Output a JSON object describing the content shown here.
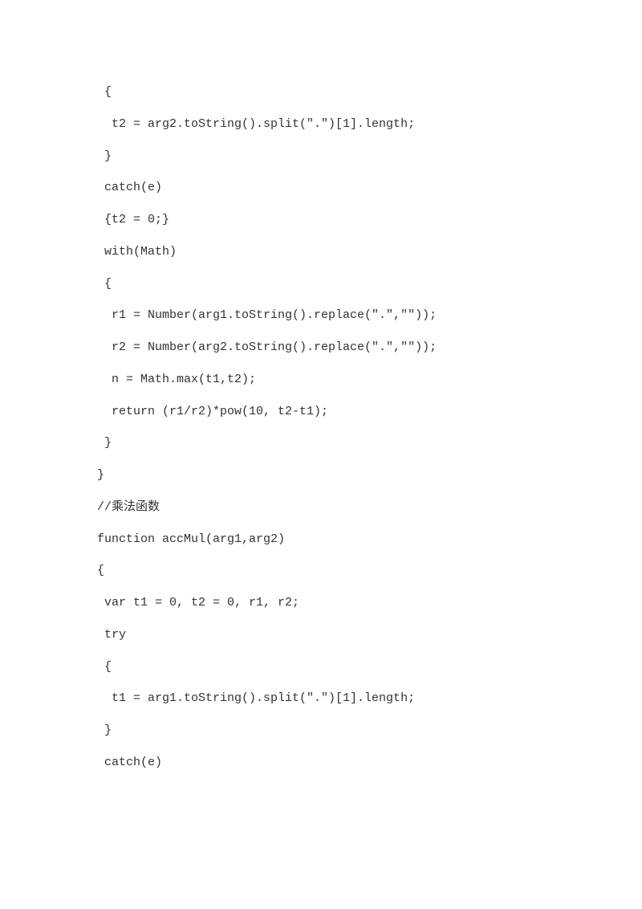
{
  "code": {
    "lines": [
      "  {",
      "   t2 = arg2.toString().split(\".\")[1].length;",
      "  }",
      "  catch(e)",
      "  {t2 = 0;}",
      "  with(Math)",
      "  {",
      "   r1 = Number(arg1.toString().replace(\".\",\"\"));",
      "   r2 = Number(arg2.toString().replace(\".\",\"\"));",
      "   n = Math.max(t1,t2);",
      "   return (r1/r2)*pow(10, t2-t1);",
      "  }",
      " }",
      " //乘法函数",
      " function accMul(arg1,arg2)",
      " {",
      "  var t1 = 0, t2 = 0, r1, r2;",
      "  try",
      "  {",
      "   t1 = arg1.toString().split(\".\")[1].length;",
      "  }",
      "  catch(e)"
    ]
  }
}
